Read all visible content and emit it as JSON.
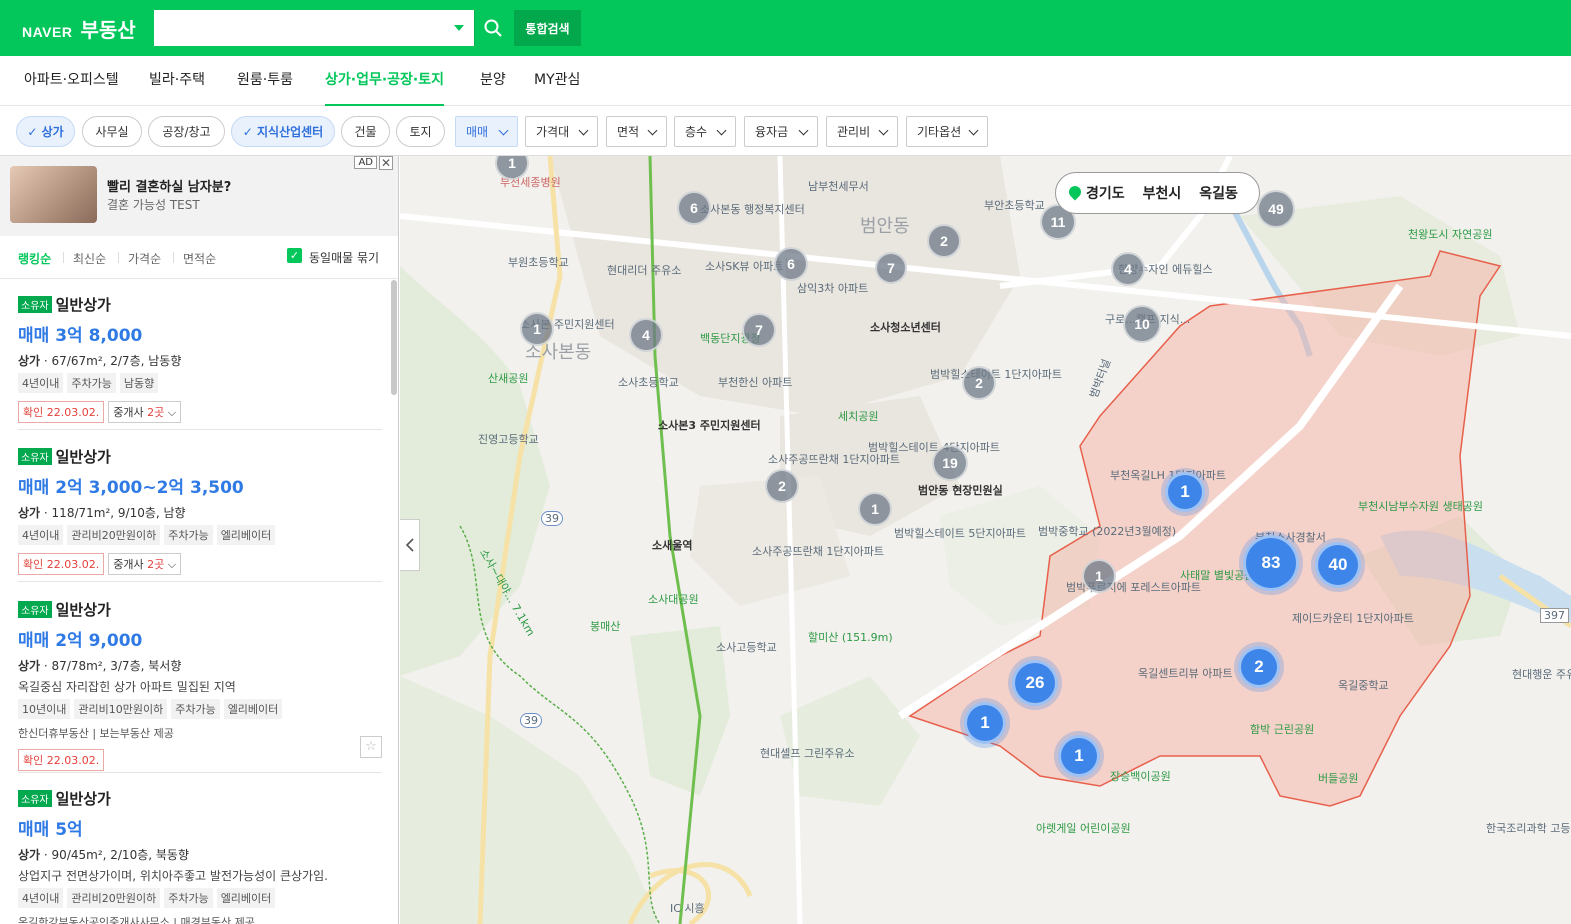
{
  "header": {
    "logo_naver": "NAVER",
    "logo_service": "부동산",
    "search_placeholder": "",
    "search_value": "",
    "total_search_label": "통합검색"
  },
  "nav": {
    "tabs": [
      {
        "label": "아파트·오피스텔"
      },
      {
        "label": "빌라·주택"
      },
      {
        "label": "원룸·투룸"
      },
      {
        "label": "상가·업무·공장·토지",
        "active": true
      },
      {
        "label": "분양"
      },
      {
        "label": "MY관심"
      }
    ]
  },
  "filters": {
    "chips": [
      {
        "label": "상가",
        "on": true
      },
      {
        "label": "사무실"
      },
      {
        "label": "공장/창고"
      },
      {
        "label": "지식산업센터",
        "on": true
      },
      {
        "label": "건물"
      },
      {
        "label": "토지"
      }
    ],
    "dropdowns": [
      {
        "label": "매매",
        "on": true
      },
      {
        "label": "가격대"
      },
      {
        "label": "면적"
      },
      {
        "label": "층수"
      },
      {
        "label": "융자금"
      },
      {
        "label": "관리비"
      },
      {
        "label": "기타옵션"
      }
    ]
  },
  "ad": {
    "title": "빨리 결혼하실 남자분?",
    "subtitle": "결혼 가능성 TEST",
    "badge": "AD",
    "close": "✕"
  },
  "sort": {
    "items": [
      "랭킹순",
      "최신순",
      "가격순",
      "면적순"
    ],
    "same_listing_label": "동일매물 묶기"
  },
  "listings": [
    {
      "badge": "소유자",
      "title": "일반상가",
      "price": "매매 3억 8,000",
      "spec_type": "상가",
      "spec": "67/67m², 2/7층, 남동향",
      "desc": "",
      "tags": [
        "4년이내",
        "주차가능",
        "남동향"
      ],
      "agency": "",
      "confirm": "확인 22.03.02.",
      "broker_prefix": "중개사",
      "broker_count": "2곳"
    },
    {
      "badge": "소유자",
      "title": "일반상가",
      "price": "매매 2억 3,000~2억 3,500",
      "spec_type": "상가",
      "spec": "118/71m², 9/10층, 남향",
      "desc": "",
      "tags": [
        "4년이내",
        "관리비20만원이하",
        "주차가능",
        "엘리베이터"
      ],
      "agency": "",
      "confirm": "확인 22.03.02.",
      "broker_prefix": "중개사",
      "broker_count": "2곳"
    },
    {
      "badge": "소유자",
      "title": "일반상가",
      "price": "매매 2억 9,000",
      "spec_type": "상가",
      "spec": "87/78m², 3/7층, 북서향",
      "desc": "옥길중심 자리잡힌 상가 아파트 밀집된 지역",
      "tags": [
        "10년이내",
        "관리비10만원이하",
        "주차가능",
        "엘리베이터"
      ],
      "agency": "한신더휴부동산 | 보는부동산 제공",
      "confirm": "확인 22.03.02.",
      "broker_prefix": "",
      "broker_count": ""
    },
    {
      "badge": "소유자",
      "title": "일반상가",
      "price": "매매 5억",
      "spec_type": "상가",
      "spec": "90/45m², 2/10층, 북동향",
      "desc": "상업지구 전면상가이며, 위치아주좋고 발전가능성이 큰상가임.",
      "tags": [
        "4년이내",
        "관리비20만원이하",
        "주차가능",
        "엘리베이터"
      ],
      "agency": "옥길한강부동산공인중개사사무소 | 매경부동산 제공",
      "confirm": "",
      "broker_prefix": "",
      "broker_count": ""
    }
  ],
  "map": {
    "location": [
      "경기도",
      "부천시",
      "옥길동"
    ],
    "gray_clusters": [
      "1",
      "6",
      "2",
      "11",
      "49",
      "6",
      "7",
      "4",
      "1",
      "4",
      "7",
      "10",
      "2",
      "19",
      "2",
      "1",
      "1"
    ],
    "blue_clusters": [
      "1",
      "83",
      "40",
      "26",
      "2",
      "1",
      "1"
    ],
    "labels": {
      "sosabondong": "소사본동",
      "beomandong": "범안동",
      "bucheon_sejong": "부천세종병원",
      "sosabon_community": "소사본동 행정복지센터",
      "nambucheon_tax": "남부천세무서",
      "buan_school": "부안초등학교",
      "bucheon_elem": "부원초등학교",
      "hyundai_leaders": "현대리더 주유소",
      "sosa_sk": "소사SK뷰 아파트",
      "samik": "삼익3차 아파트",
      "sosa_youth": "소사청소년센터",
      "hanyang": "한양수자인 에듀힐스",
      "cheonwang": "천왕도시 자연공원",
      "guro": "구로...캠프 지식...",
      "sosabon1": "소사본 주민지원센터",
      "sansae_park": "산새공원",
      "sosa_elem": "소사초등학교",
      "baekdong": "백동단지광장",
      "bucheon_hanshin": "부천한신 아파트",
      "beombak_1": "범박힐스테이트 1단지아파트",
      "sese_park": "세치공원",
      "jinyoung": "진영고등학교",
      "sosabon3": "소사본3 주민지원센터",
      "beombak_4": "범박힐스테이트 4단지아파트",
      "sosa_junggong": "소사주공뜨란채 1단지아파트",
      "beoman_office": "범안동 현장민원실",
      "okgil_lh": "부천옥길LH 1단지아파트",
      "bucheon_nam_police": "부천소사경찰서",
      "bucheon_namsu": "부천시남부수자원 생태공원",
      "sosae_station": "소새울역",
      "beombak_5": "범박힐스테이트 5단지아파트",
      "beombak_middle": "범박중학교 (2022년3월예정)",
      "sataeum": "사태말 별빛공원",
      "sosadae_park": "소사대공원",
      "sosa_junggong2": "소사주공뜨란채 1단지아파트",
      "beombak_prugio": "범박푸르지에 포레스트아파트",
      "jeil": "제이드카운티 1단지아파트",
      "bongmaesan": "봉매산",
      "halmisan": "할미산 (151.9m)",
      "sosa_high": "소사고등학교",
      "okgil_centre": "옥길센트리뷰 아파트",
      "okgil_middle": "옥길중학교",
      "hyundai_gas": "현대행운 주유소",
      "hyundai_self": "현대셀프 그린주유소",
      "hambak": "함박 근린공원",
      "jangseung": "장승백이공원",
      "beodeul": "버들공원",
      "arelgae": "아렛게일 어린이공원",
      "korea_cook": "한국조리과학 고등학교",
      "trail": "소사~대야... 7.1km",
      "road_39": "39",
      "road_397": "397",
      "ic": "IC 시흥",
      "ganggang": "범박터널"
    }
  }
}
